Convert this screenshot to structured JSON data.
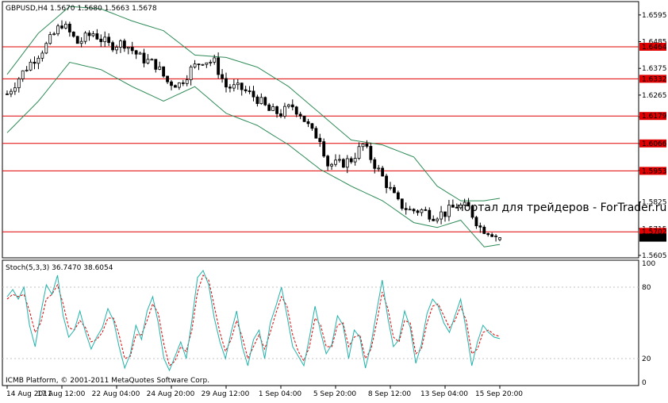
{
  "colors": {
    "background": "#ffffff",
    "candle": "#000000",
    "bands": "#2e8b57",
    "levels": "#e00000",
    "stoch_main": "#20b2aa",
    "stoch_signal": "#e00000",
    "price_tag_bg": "#e00000",
    "price_tag_text": "#ffffff"
  },
  "main_panel": {
    "header": "GBPUSD,H4  1.5670 1.5680 1.5663 1.5678",
    "watermark": "портал для трейдеров - ForTrader.ru"
  },
  "stoch_panel": {
    "header": "Stoch(5,3,3) 36.7470 38.6054",
    "footer": "ICMB Platform, © 2001-2011 MetaQuotes Software Corp."
  },
  "x_ticks": [
    "14 Aug 2011",
    "17 Aug 12:00",
    "22 Aug 04:00",
    "24 Aug 20:00",
    "29 Aug 12:00",
    "1 Sep 04:00",
    "5 Sep 20:00",
    "8 Sep 12:00",
    "13 Sep 04:00",
    "15 Sep 20:00"
  ],
  "price_ticks": [
    "1.6595",
    "1.6485",
    "1.6375",
    "1.6265",
    "1.6175",
    "1.6065",
    "1.5955",
    "1.5825",
    "1.5715",
    "1.5605"
  ],
  "price_tags": [
    "1.6464",
    "1.6332",
    "1.6179",
    "1.6066",
    "1.5953",
    "1.5702",
    "1.5678"
  ],
  "stoch_ticks": [
    "100",
    "80",
    "20",
    "0"
  ],
  "chart_data": [
    {
      "type": "candlestick",
      "title": "GBPUSD,H4",
      "ohlc_last": {
        "open": 1.567,
        "high": 1.568,
        "low": 1.5663,
        "close": 1.5678
      },
      "ylim": [
        1.5595,
        1.665
      ],
      "horizontal_levels": [
        1.6464,
        1.6332,
        1.6179,
        1.6066,
        1.5953,
        1.5702
      ],
      "close_path": [
        [
          0,
          1.627
        ],
        [
          5,
          1.638
        ],
        [
          10,
          1.647
        ],
        [
          14,
          1.656
        ],
        [
          18,
          1.648
        ],
        [
          22,
          1.652
        ],
        [
          26,
          1.647
        ],
        [
          30,
          1.648
        ],
        [
          34,
          1.642
        ],
        [
          38,
          1.639
        ],
        [
          41,
          1.632
        ],
        [
          44,
          1.631
        ],
        [
          47,
          1.637
        ],
        [
          50,
          1.641
        ],
        [
          53,
          1.64
        ],
        [
          56,
          1.63
        ],
        [
          60,
          1.629
        ],
        [
          64,
          1.625
        ],
        [
          67,
          1.62
        ],
        [
          70,
          1.619
        ],
        [
          73,
          1.622
        ],
        [
          75,
          1.619
        ],
        [
          78,
          1.611
        ],
        [
          80,
          1.609
        ],
        [
          82,
          1.598
        ],
        [
          85,
          1.598
        ],
        [
          88,
          1.6
        ],
        [
          91,
          1.606
        ],
        [
          94,
          1.598
        ],
        [
          97,
          1.59
        ],
        [
          100,
          1.582
        ],
        [
          103,
          1.579
        ],
        [
          106,
          1.579
        ],
        [
          109,
          1.577
        ],
        [
          112,
          1.578
        ],
        [
          115,
          1.581
        ],
        [
          118,
          1.58
        ],
        [
          121,
          1.572
        ],
        [
          124,
          1.57
        ],
        [
          126,
          1.5678
        ]
      ],
      "upper_band_path": [
        [
          0,
          1.635
        ],
        [
          8,
          1.652
        ],
        [
          16,
          1.663
        ],
        [
          24,
          1.662
        ],
        [
          32,
          1.657
        ],
        [
          40,
          1.653
        ],
        [
          48,
          1.643
        ],
        [
          56,
          1.642
        ],
        [
          64,
          1.638
        ],
        [
          72,
          1.63
        ],
        [
          80,
          1.619
        ],
        [
          88,
          1.608
        ],
        [
          96,
          1.606
        ],
        [
          104,
          1.601
        ],
        [
          110,
          1.589
        ],
        [
          116,
          1.583
        ],
        [
          122,
          1.583
        ],
        [
          126,
          1.584
        ]
      ],
      "lower_band_path": [
        [
          0,
          1.611
        ],
        [
          8,
          1.624
        ],
        [
          16,
          1.64
        ],
        [
          24,
          1.637
        ],
        [
          32,
          1.63
        ],
        [
          40,
          1.624
        ],
        [
          48,
          1.63
        ],
        [
          56,
          1.619
        ],
        [
          64,
          1.614
        ],
        [
          72,
          1.606
        ],
        [
          80,
          1.596
        ],
        [
          88,
          1.589
        ],
        [
          96,
          1.583
        ],
        [
          104,
          1.574
        ],
        [
          110,
          1.572
        ],
        [
          116,
          1.575
        ],
        [
          122,
          1.564
        ],
        [
          126,
          1.565
        ]
      ],
      "bars": 127
    },
    {
      "type": "line",
      "title": "Stoch(5,3,3)",
      "ylim": [
        0,
        100
      ],
      "series": [
        {
          "name": "Stoch(5,3,3)",
          "last": 36.747,
          "values": [
            72,
            78,
            70,
            80,
            48,
            30,
            58,
            82,
            74,
            90,
            56,
            38,
            44,
            60,
            42,
            28,
            38,
            46,
            62,
            52,
            30,
            12,
            24,
            48,
            36,
            60,
            72,
            50,
            20,
            10,
            22,
            34,
            20,
            52,
            88,
            94,
            82,
            54,
            34,
            20,
            42,
            60,
            30,
            14,
            36,
            44,
            20,
            50,
            64,
            80,
            56,
            30,
            22,
            14,
            38,
            64,
            42,
            24,
            32,
            56,
            48,
            20,
            44,
            38,
            12,
            32,
            60,
            86,
            54,
            30,
            36,
            60,
            46,
            16,
            32,
            58,
            70,
            64,
            50,
            42,
            56,
            70,
            44,
            14,
            34,
            48,
            42,
            38,
            36.7
          ]
        },
        {
          "name": "Signal",
          "last": 38.6054,
          "values": [
            70,
            74,
            72,
            74,
            60,
            42,
            50,
            70,
            74,
            82,
            66,
            46,
            44,
            52,
            46,
            34,
            36,
            42,
            54,
            54,
            40,
            20,
            22,
            40,
            40,
            52,
            66,
            58,
            32,
            14,
            18,
            30,
            26,
            44,
            76,
            90,
            86,
            64,
            42,
            26,
            36,
            52,
            38,
            20,
            30,
            40,
            28,
            42,
            58,
            72,
            64,
            40,
            26,
            18,
            30,
            54,
            48,
            30,
            30,
            48,
            50,
            30,
            38,
            40,
            20,
            28,
            50,
            76,
            62,
            38,
            34,
            52,
            50,
            24,
            28,
            50,
            64,
            66,
            56,
            46,
            52,
            64,
            52,
            24,
            28,
            42,
            44,
            40,
            38.6
          ]
        }
      ]
    }
  ]
}
